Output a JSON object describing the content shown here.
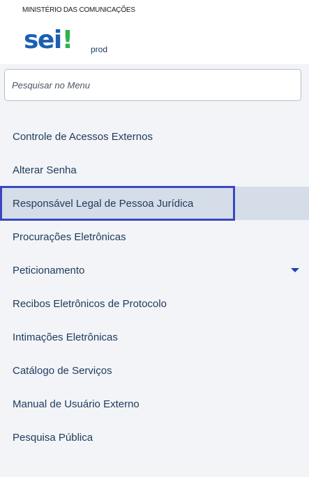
{
  "header": {
    "org_name": "MINISTÉRIO DAS COMUNICAÇÕES",
    "logo_text": "sei",
    "logo_mark": "!",
    "environment": "prod"
  },
  "search": {
    "placeholder": "Pesquisar no Menu",
    "value": ""
  },
  "menu": {
    "active_index": 2,
    "items": [
      {
        "label": "Controle de Acessos Externos"
      },
      {
        "label": "Alterar Senha"
      },
      {
        "label": "Responsável Legal de Pessoa Jurídica"
      },
      {
        "label": "Procurações Eletrônicas"
      },
      {
        "label": "Peticionamento",
        "icon": "chevron-down-icon"
      },
      {
        "label": "Recibos Eletrônicos de Protocolo"
      },
      {
        "label": "Intimações Eletrônicas"
      },
      {
        "label": "Catálogo de Serviços"
      },
      {
        "label": "Manual de Usuário Externo"
      },
      {
        "label": "Pesquisa Pública"
      }
    ]
  },
  "colors": {
    "logo_blue": "#1a5fb4",
    "logo_green": "#2db34a",
    "active_bg": "#d5dde9",
    "active_border": "#3a46c2",
    "menu_text": "#1e3a5c"
  }
}
